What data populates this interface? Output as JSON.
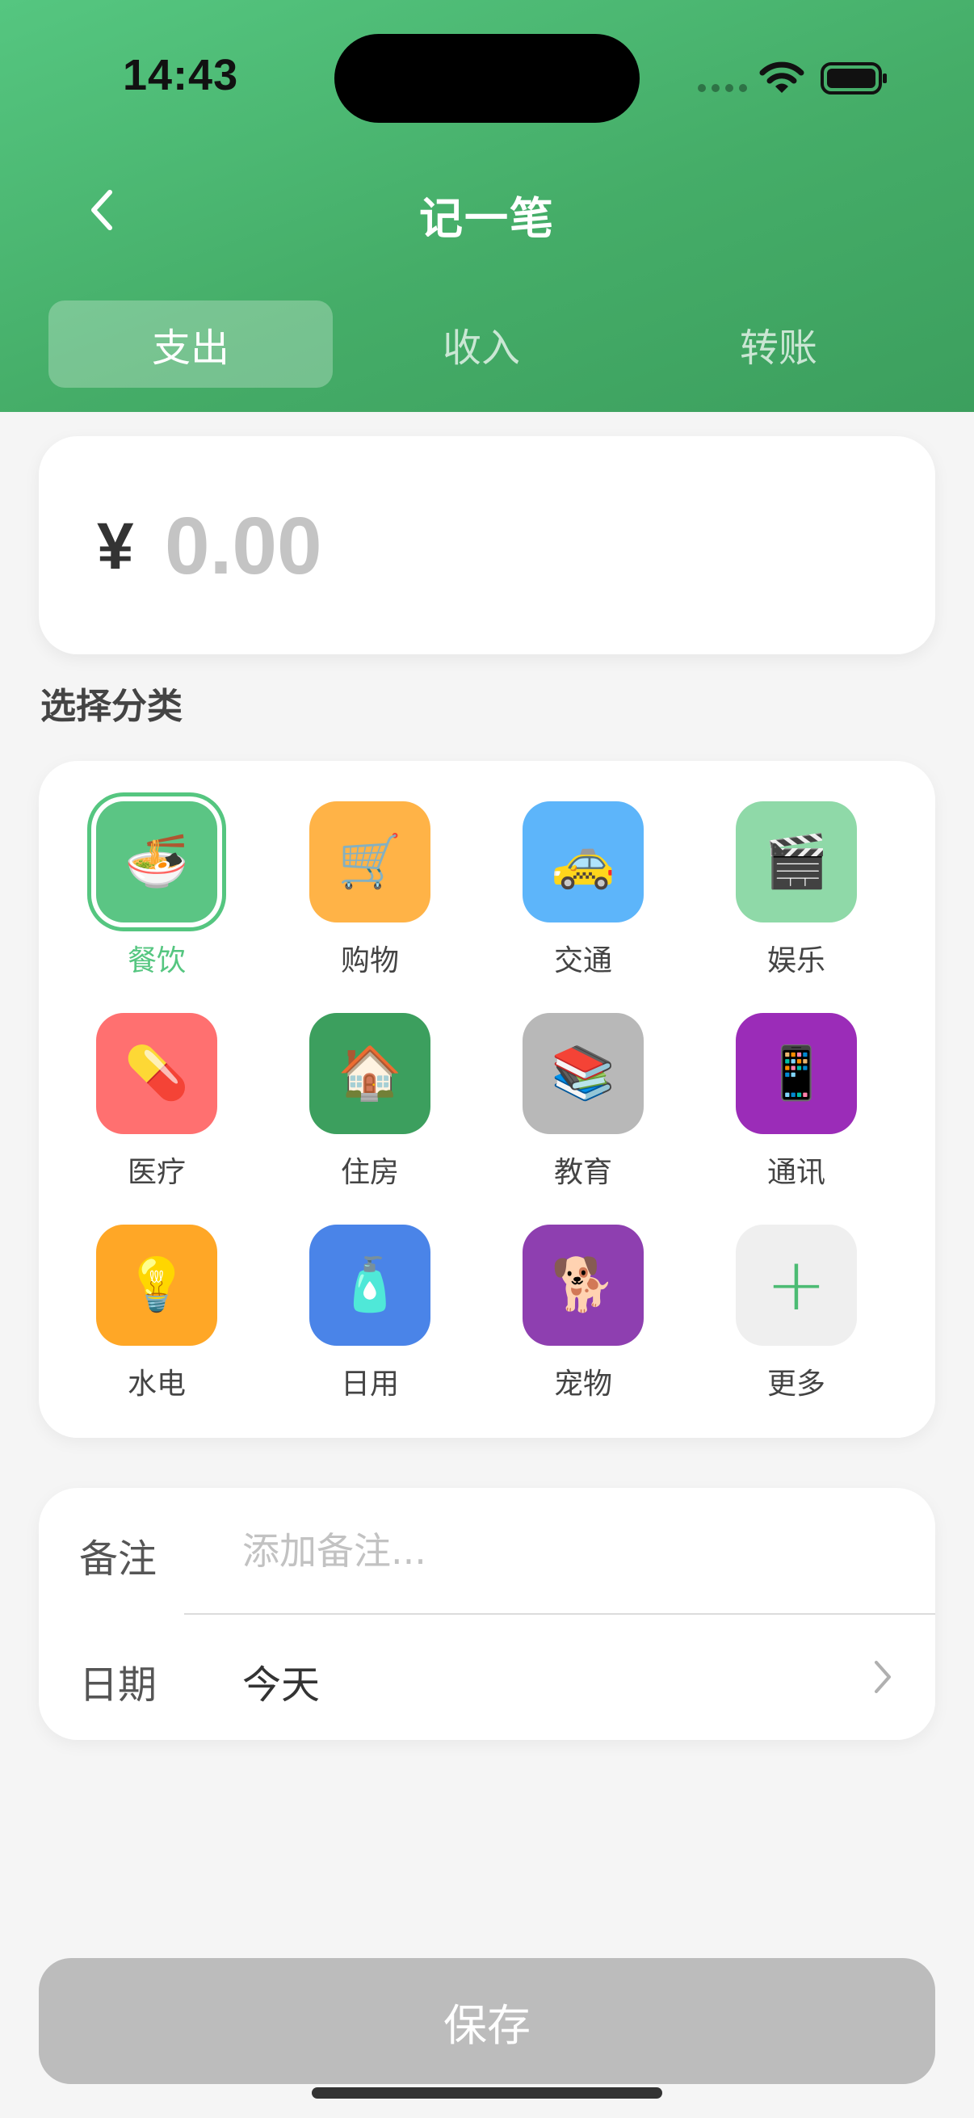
{
  "status_bar": {
    "time": "14:43"
  },
  "header": {
    "title": "记一笔"
  },
  "tabs": [
    {
      "label": "支出",
      "active": true
    },
    {
      "label": "收入",
      "active": false
    },
    {
      "label": "转账",
      "active": false
    }
  ],
  "amount": {
    "currency": "¥",
    "placeholder": "0.00",
    "value": ""
  },
  "category_section": {
    "label": "选择分类",
    "selected": "餐饮",
    "items": [
      {
        "label": "餐饮",
        "emoji": "🍜",
        "icon": "noodle-bowl-icon",
        "color": "#5bc584"
      },
      {
        "label": "购物",
        "emoji": "🛒",
        "icon": "shopping-cart-icon",
        "color": "#ffb347"
      },
      {
        "label": "交通",
        "emoji": "🚕",
        "icon": "taxi-icon",
        "color": "#5db5fa"
      },
      {
        "label": "娱乐",
        "emoji": "🎬",
        "icon": "clapperboard-icon",
        "color": "#8fd9a8"
      },
      {
        "label": "医疗",
        "emoji": "💊",
        "icon": "pill-icon",
        "color": "#ff7070"
      },
      {
        "label": "住房",
        "emoji": "🏠",
        "icon": "house-icon",
        "color": "#3c9f5e"
      },
      {
        "label": "教育",
        "emoji": "📚",
        "icon": "books-icon",
        "color": "#b8b8b8"
      },
      {
        "label": "通讯",
        "emoji": "📱",
        "icon": "mobile-phone-icon",
        "color": "#9b2cb8"
      },
      {
        "label": "水电",
        "emoji": "💡",
        "icon": "light-bulb-icon",
        "color": "#ffa726"
      },
      {
        "label": "日用",
        "emoji": "🧴",
        "icon": "lotion-bottle-icon",
        "color": "#4a84e8"
      },
      {
        "label": "宠物",
        "emoji": "🐕",
        "icon": "dog-icon",
        "color": "#8e3fb0"
      },
      {
        "label": "更多",
        "emoji": "+",
        "icon": "plus-icon",
        "color": "#efefef"
      }
    ]
  },
  "form": {
    "note_label": "备注",
    "note_placeholder": "添加备注...",
    "note_value": "",
    "date_label": "日期",
    "date_value": "今天"
  },
  "save_label": "保存"
}
